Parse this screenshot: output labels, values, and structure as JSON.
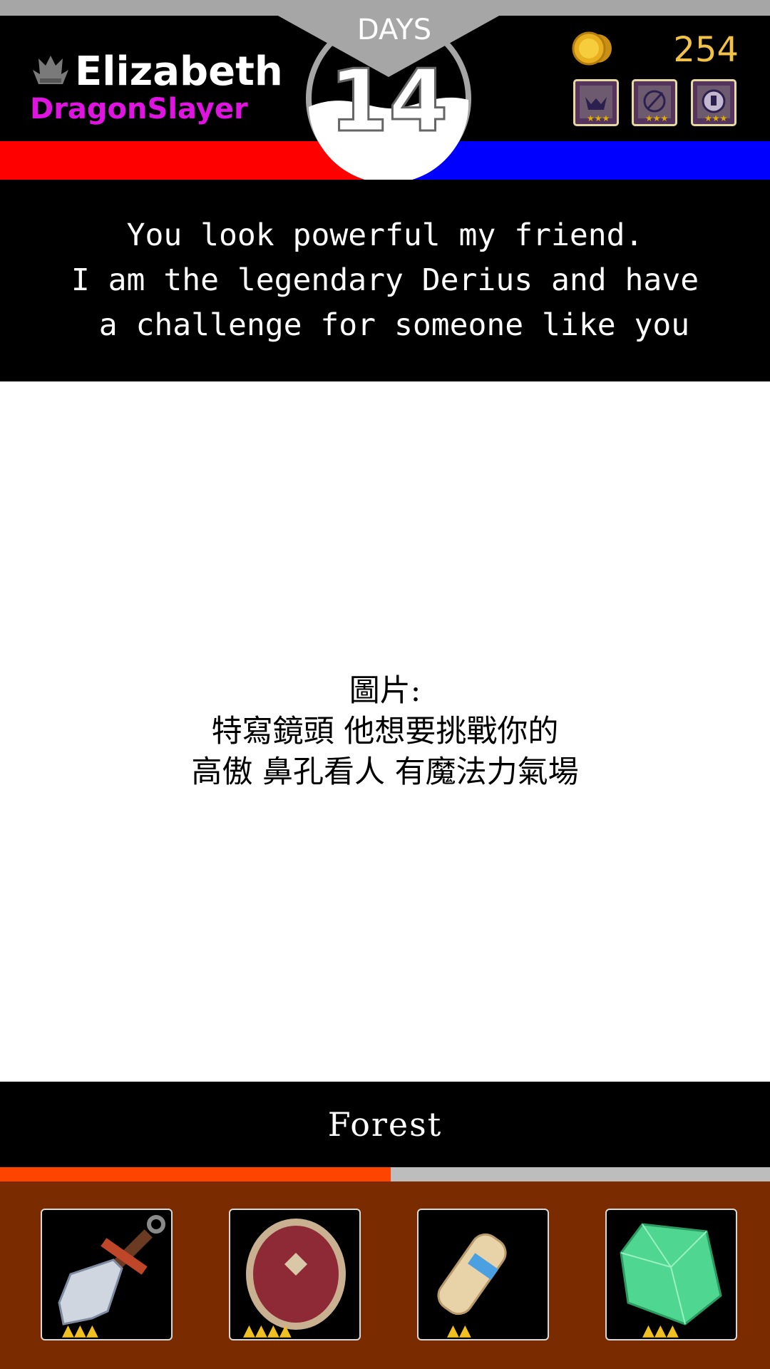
{
  "player": {
    "name": "Elizabeth",
    "title": "DragonSlayer",
    "crest_icon": "crest-icon"
  },
  "days": {
    "label": "DAYS",
    "count": "14"
  },
  "currency": {
    "icon": "coin-icon",
    "amount": "254"
  },
  "badges": [
    {
      "icon": "monster-badge-icon"
    },
    {
      "icon": "compass-badge-icon"
    },
    {
      "icon": "gear-badge-icon"
    }
  ],
  "dialog": {
    "lines": [
      "You look powerful my friend.",
      "I am the legendary Derius and have",
      " a challenge for someone like you"
    ]
  },
  "scene": {
    "lines": [
      "圖片:",
      "特寫鏡頭 他想要挑戰你的",
      "高傲 鼻孔看人 有魔法力氣場"
    ]
  },
  "location": {
    "name": "Forest",
    "progress": 0.507
  },
  "colors": {
    "player_bar": "#fe0000",
    "enemy_bar": "#0000fe",
    "title": "#e014e0",
    "coins": "#f2c248",
    "progress": "#fe4500",
    "tray": "#7a2c00"
  },
  "inventory": [
    {
      "icon": "dagger-icon",
      "stars": 3
    },
    {
      "icon": "shield-icon",
      "stars": 4
    },
    {
      "icon": "scroll-icon",
      "stars": 2
    },
    {
      "icon": "crystal-icon",
      "stars": 3
    }
  ]
}
